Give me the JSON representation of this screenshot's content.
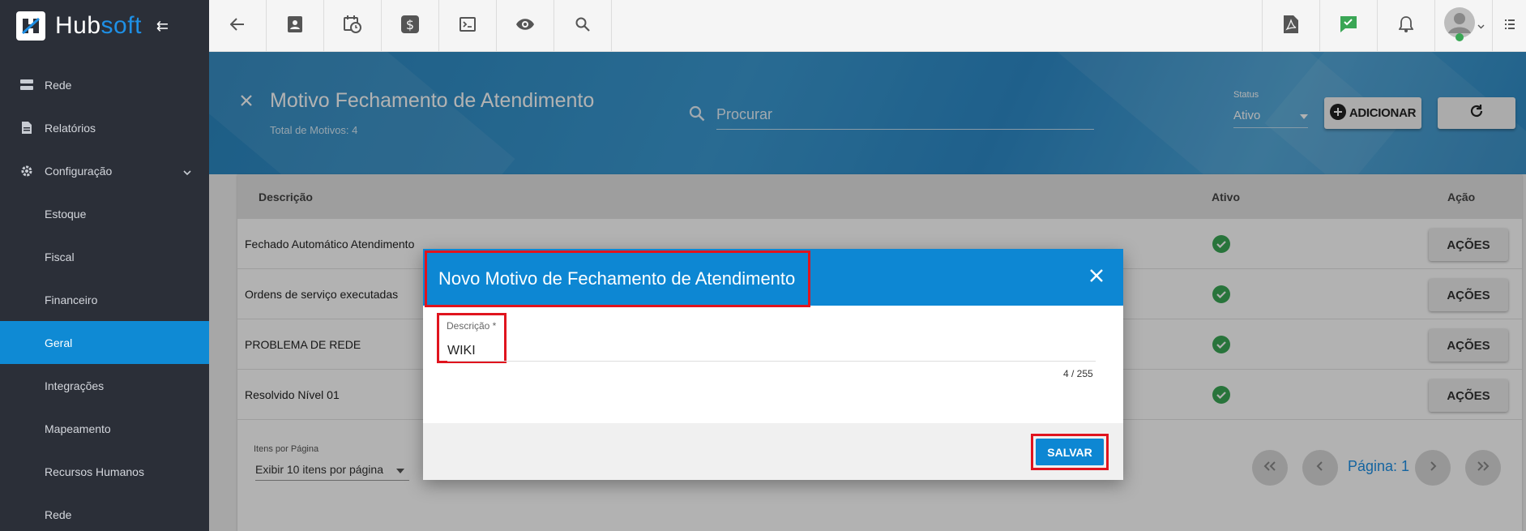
{
  "brand": {
    "name_part1": "Hub",
    "name_part2": "soft"
  },
  "sidebar": {
    "items": [
      {
        "label": "Rede",
        "icon": "server-icon"
      },
      {
        "label": "Relatórios",
        "icon": "document-icon"
      },
      {
        "label": "Configuração",
        "icon": "gear-icon"
      },
      {
        "label": "Estoque"
      },
      {
        "label": "Fiscal"
      },
      {
        "label": "Financeiro"
      },
      {
        "label": "Geral"
      },
      {
        "label": "Integrações"
      },
      {
        "label": "Mapeamento"
      },
      {
        "label": "Recursos Humanos"
      },
      {
        "label": "Rede"
      }
    ],
    "active": "Geral"
  },
  "header": {
    "title": "Motivo Fechamento de Atendimento",
    "subtitle": "Total de Motivos: 4",
    "search_placeholder": "Procurar",
    "status_label": "Status",
    "status_value": "Ativo",
    "add_label": "ADICIONAR"
  },
  "table": {
    "columns": [
      "Descrição",
      "Ativo",
      "Ação"
    ],
    "rows": [
      {
        "descricao": "Fechado Automático Atendimento",
        "action": "AÇÕES"
      },
      {
        "descricao": "Ordens de serviço executadas",
        "action": "AÇÕES"
      },
      {
        "descricao": "PROBLEMA DE REDE",
        "action": "AÇÕES"
      },
      {
        "descricao": "Resolvido Nível 01",
        "action": "AÇÕES"
      }
    ],
    "items_per_page_label": "Itens por Página",
    "items_per_page_value": "Exibir 10 itens por página",
    "page_label": "Página: 1"
  },
  "dialog": {
    "title": "Novo Motivo de Fechamento de Atendimento",
    "field_label": "Descrição *",
    "field_value": "WIKI",
    "counter": "4 / 255",
    "save_label": "SALVAR"
  },
  "colors": {
    "primary": "#0d87d3",
    "sidebar": "#2b2f38",
    "highlight": "#e0141e",
    "check": "#3aa655"
  }
}
